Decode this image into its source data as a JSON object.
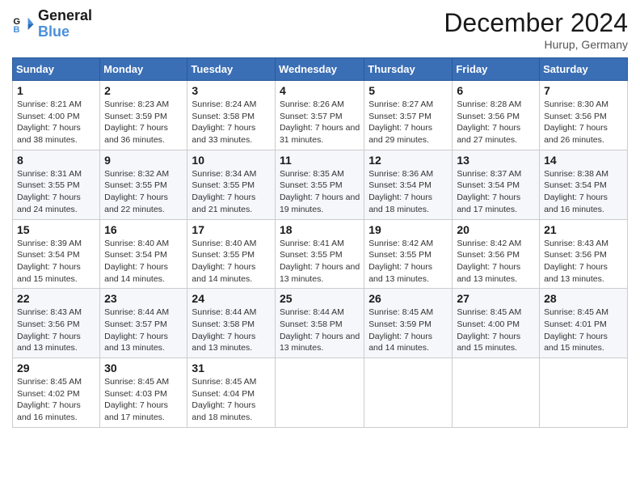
{
  "logo": {
    "line1": "General",
    "line2": "Blue"
  },
  "title": "December 2024",
  "location": "Hurup, Germany",
  "weekdays": [
    "Sunday",
    "Monday",
    "Tuesday",
    "Wednesday",
    "Thursday",
    "Friday",
    "Saturday"
  ],
  "weeks": [
    [
      {
        "day": "1",
        "sunrise": "8:21 AM",
        "sunset": "4:00 PM",
        "daylight": "7 hours and 38 minutes."
      },
      {
        "day": "2",
        "sunrise": "8:23 AM",
        "sunset": "3:59 PM",
        "daylight": "7 hours and 36 minutes."
      },
      {
        "day": "3",
        "sunrise": "8:24 AM",
        "sunset": "3:58 PM",
        "daylight": "7 hours and 33 minutes."
      },
      {
        "day": "4",
        "sunrise": "8:26 AM",
        "sunset": "3:57 PM",
        "daylight": "7 hours and 31 minutes."
      },
      {
        "day": "5",
        "sunrise": "8:27 AM",
        "sunset": "3:57 PM",
        "daylight": "7 hours and 29 minutes."
      },
      {
        "day": "6",
        "sunrise": "8:28 AM",
        "sunset": "3:56 PM",
        "daylight": "7 hours and 27 minutes."
      },
      {
        "day": "7",
        "sunrise": "8:30 AM",
        "sunset": "3:56 PM",
        "daylight": "7 hours and 26 minutes."
      }
    ],
    [
      {
        "day": "8",
        "sunrise": "8:31 AM",
        "sunset": "3:55 PM",
        "daylight": "7 hours and 24 minutes."
      },
      {
        "day": "9",
        "sunrise": "8:32 AM",
        "sunset": "3:55 PM",
        "daylight": "7 hours and 22 minutes."
      },
      {
        "day": "10",
        "sunrise": "8:34 AM",
        "sunset": "3:55 PM",
        "daylight": "7 hours and 21 minutes."
      },
      {
        "day": "11",
        "sunrise": "8:35 AM",
        "sunset": "3:55 PM",
        "daylight": "7 hours and 19 minutes."
      },
      {
        "day": "12",
        "sunrise": "8:36 AM",
        "sunset": "3:54 PM",
        "daylight": "7 hours and 18 minutes."
      },
      {
        "day": "13",
        "sunrise": "8:37 AM",
        "sunset": "3:54 PM",
        "daylight": "7 hours and 17 minutes."
      },
      {
        "day": "14",
        "sunrise": "8:38 AM",
        "sunset": "3:54 PM",
        "daylight": "7 hours and 16 minutes."
      }
    ],
    [
      {
        "day": "15",
        "sunrise": "8:39 AM",
        "sunset": "3:54 PM",
        "daylight": "7 hours and 15 minutes."
      },
      {
        "day": "16",
        "sunrise": "8:40 AM",
        "sunset": "3:54 PM",
        "daylight": "7 hours and 14 minutes."
      },
      {
        "day": "17",
        "sunrise": "8:40 AM",
        "sunset": "3:55 PM",
        "daylight": "7 hours and 14 minutes."
      },
      {
        "day": "18",
        "sunrise": "8:41 AM",
        "sunset": "3:55 PM",
        "daylight": "7 hours and 13 minutes."
      },
      {
        "day": "19",
        "sunrise": "8:42 AM",
        "sunset": "3:55 PM",
        "daylight": "7 hours and 13 minutes."
      },
      {
        "day": "20",
        "sunrise": "8:42 AM",
        "sunset": "3:56 PM",
        "daylight": "7 hours and 13 minutes."
      },
      {
        "day": "21",
        "sunrise": "8:43 AM",
        "sunset": "3:56 PM",
        "daylight": "7 hours and 13 minutes."
      }
    ],
    [
      {
        "day": "22",
        "sunrise": "8:43 AM",
        "sunset": "3:56 PM",
        "daylight": "7 hours and 13 minutes."
      },
      {
        "day": "23",
        "sunrise": "8:44 AM",
        "sunset": "3:57 PM",
        "daylight": "7 hours and 13 minutes."
      },
      {
        "day": "24",
        "sunrise": "8:44 AM",
        "sunset": "3:58 PM",
        "daylight": "7 hours and 13 minutes."
      },
      {
        "day": "25",
        "sunrise": "8:44 AM",
        "sunset": "3:58 PM",
        "daylight": "7 hours and 13 minutes."
      },
      {
        "day": "26",
        "sunrise": "8:45 AM",
        "sunset": "3:59 PM",
        "daylight": "7 hours and 14 minutes."
      },
      {
        "day": "27",
        "sunrise": "8:45 AM",
        "sunset": "4:00 PM",
        "daylight": "7 hours and 15 minutes."
      },
      {
        "day": "28",
        "sunrise": "8:45 AM",
        "sunset": "4:01 PM",
        "daylight": "7 hours and 15 minutes."
      }
    ],
    [
      {
        "day": "29",
        "sunrise": "8:45 AM",
        "sunset": "4:02 PM",
        "daylight": "7 hours and 16 minutes."
      },
      {
        "day": "30",
        "sunrise": "8:45 AM",
        "sunset": "4:03 PM",
        "daylight": "7 hours and 17 minutes."
      },
      {
        "day": "31",
        "sunrise": "8:45 AM",
        "sunset": "4:04 PM",
        "daylight": "7 hours and 18 minutes."
      },
      null,
      null,
      null,
      null
    ]
  ],
  "labels": {
    "sunrise": "Sunrise:",
    "sunset": "Sunset:",
    "daylight": "Daylight:"
  }
}
